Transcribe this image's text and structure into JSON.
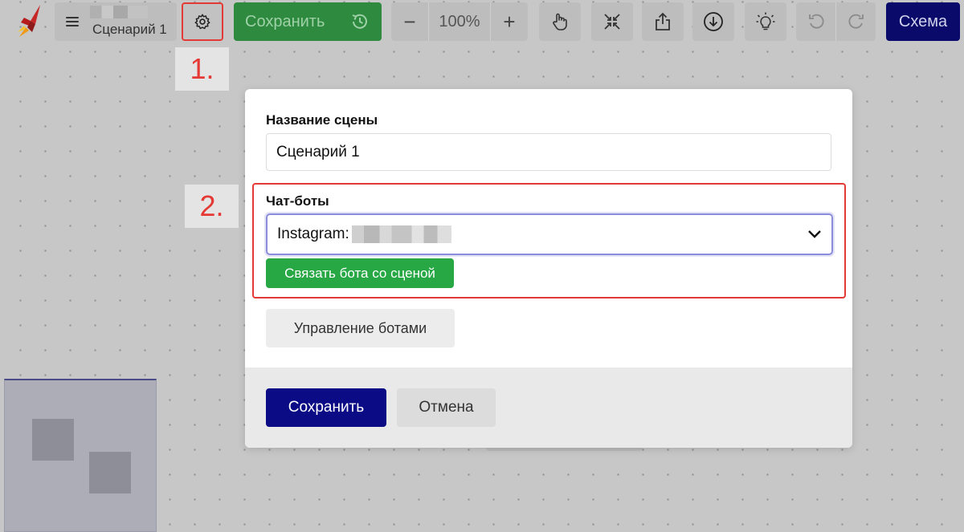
{
  "toolbar": {
    "scene_name": "Сценарий 1",
    "save_label": "Сохранить",
    "zoom_out": "−",
    "zoom_value": "100%",
    "zoom_in": "+",
    "schema_label": "Схема",
    "icons": [
      "menu-icon",
      "gear-icon",
      "history-icon",
      "hand-icon",
      "fit-icon",
      "share-icon",
      "download-icon",
      "lightbulb-icon",
      "undo-icon",
      "redo-icon"
    ]
  },
  "steps": {
    "step1": "1.",
    "step2": "2."
  },
  "modal": {
    "scene_name_label": "Название сцены",
    "scene_name_value": "Сценарий 1",
    "chatbots_label": "Чат-боты",
    "chatbot_selected": "Instagram:",
    "link_button": "Связать бота со сценой",
    "manage_button": "Управление ботами",
    "save_button": "Сохранить",
    "cancel_button": "Отмена"
  },
  "colors": {
    "highlight": "#e53935",
    "primary": "#0b0b85",
    "success": "#28a745"
  }
}
